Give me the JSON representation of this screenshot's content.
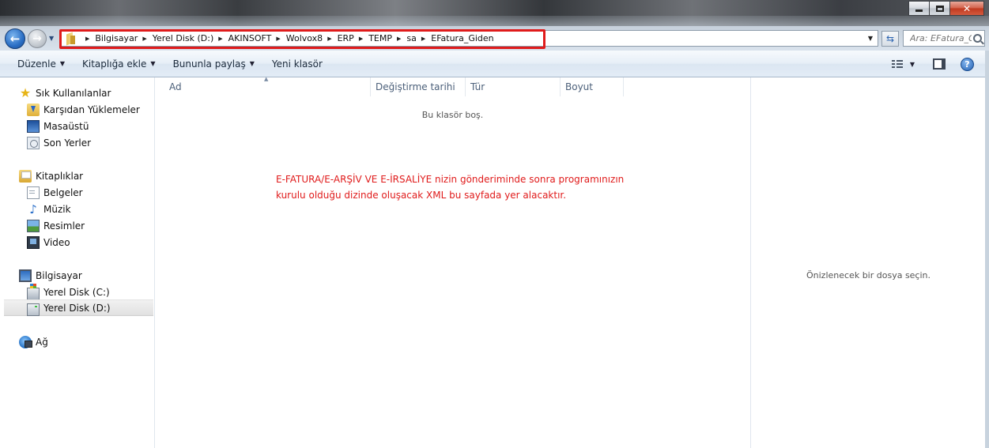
{
  "window": {
    "minimize_label": "–",
    "maximize_label": "□",
    "close_label": "✕"
  },
  "nav": {
    "back_icon": "back-arrow-icon",
    "forward_icon": "forward-arrow-icon",
    "breadcrumbs": [
      "Bilgisayar",
      "Yerel Disk (D:)",
      "AKINSOFT",
      "Wolvox8",
      "ERP",
      "TEMP",
      "sa",
      "EFatura_Giden"
    ],
    "search_placeholder": "Ara: EFatura_Giden",
    "highlight_color": "#e01b1b"
  },
  "toolbar": {
    "organize": "Düzenle",
    "include_library": "Kitaplığa ekle",
    "share_with": "Bununla paylaş",
    "new_folder": "Yeni klasör"
  },
  "sidebar": {
    "favorites": {
      "label": "Sık Kullanılanlar",
      "items": [
        "Karşıdan Yüklemeler",
        "Masaüstü",
        "Son Yerler"
      ]
    },
    "libraries": {
      "label": "Kitaplıklar",
      "items": [
        "Belgeler",
        "Müzik",
        "Resimler",
        "Video"
      ]
    },
    "computer": {
      "label": "Bilgisayar",
      "items": [
        "Yerel Disk (C:)",
        "Yerel Disk (D:)"
      ],
      "selected": "Yerel Disk (D:)"
    },
    "network": {
      "label": "Ağ"
    }
  },
  "filelist": {
    "columns": [
      "Ad",
      "Değiştirme tarihi",
      "Tür",
      "Boyut"
    ],
    "empty_message": "Bu klasör boş.",
    "annotation_lines": [
      "E-FATURA/E-ARŞİV VE E-İRSALİYE nizin gönderiminde sonra programınızın",
      "kurulu olduğu dizinde oluşacak XML bu sayfada yer alacaktır."
    ],
    "annotation_color": "#e01b1b"
  },
  "preview": {
    "message": "Önizlenecek bir dosya seçin."
  }
}
